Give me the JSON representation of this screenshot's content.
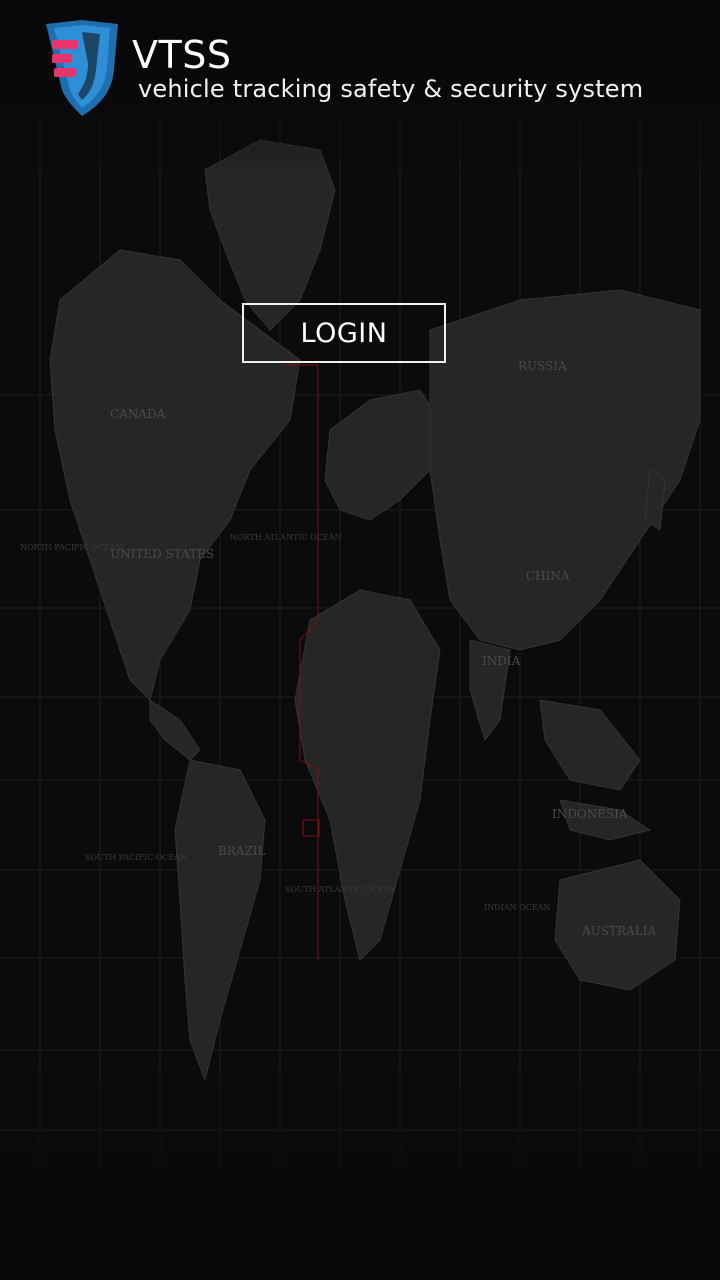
{
  "app": {
    "title": "VTSS",
    "subtitle": "vehicle tracking safety & security system"
  },
  "login": {
    "label": "LOGIN"
  },
  "map": {
    "labels": {
      "canada": "CANADA",
      "russia": "RUSSIA",
      "united_states": "UNITED STATES",
      "china": "CHINA",
      "brazil": "BRAZIL",
      "india": "INDIA",
      "indonesia": "INDONESIA",
      "australia": "AUSTRALIA",
      "north_pacific": "NORTH PACIFIC OCEAN",
      "south_pacific": "SOUTH PACIFIC OCEAN",
      "north_atlantic": "NORTH ATLANTIC OCEAN",
      "south_atlantic": "SOUTH ATLANTIC OCEAN",
      "indian_ocean": "INDIAN OCEAN"
    }
  },
  "colors": {
    "background": "#080808",
    "land": "#2a2a2a",
    "grid": "#1c1c1c",
    "accent_pink": "#e8336d",
    "accent_blue": "#2f8fd6",
    "meridian_red": "#7a1010",
    "text": "#ffffff"
  },
  "icons": {
    "logo": "vtss-shield-logo"
  }
}
